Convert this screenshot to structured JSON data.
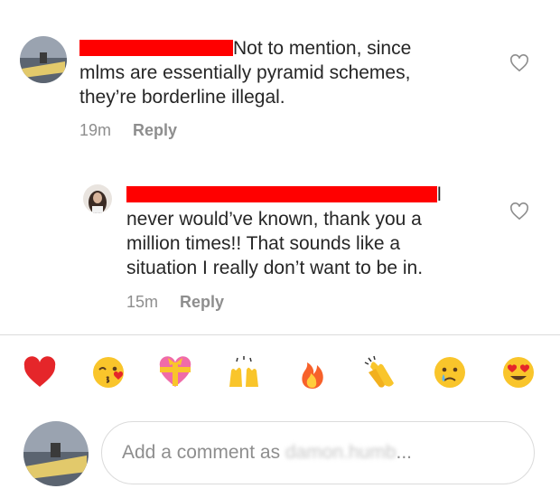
{
  "comments": [
    {
      "text_line1": "Not to mention, since",
      "text_line2": "mlms are essentially pyramid schemes,",
      "text_line3": "they’re borderline illegal.",
      "time": "19m",
      "reply_label": "Reply"
    },
    {
      "text_line1_suffix": "l",
      "text_line2": "never would’ve known, thank you a",
      "text_line3": "million times!! That sounds like a",
      "text_line4": "situation I really don’t want to be in.",
      "time": "15m",
      "reply_label": "Reply"
    }
  ],
  "emoji_bar": [
    "red-heart",
    "face-blowing-kiss",
    "heart-with-ribbon",
    "raising-hands",
    "fire",
    "clapping-hands",
    "crying-face",
    "heart-eyes"
  ],
  "composer": {
    "placeholder_prefix": "Add a comment as ",
    "username_blurred": "damon.humb",
    "ellipsis": "..."
  },
  "colors": {
    "redaction": "#ff0000",
    "muted": "#8e8e8e",
    "text": "#262626"
  }
}
